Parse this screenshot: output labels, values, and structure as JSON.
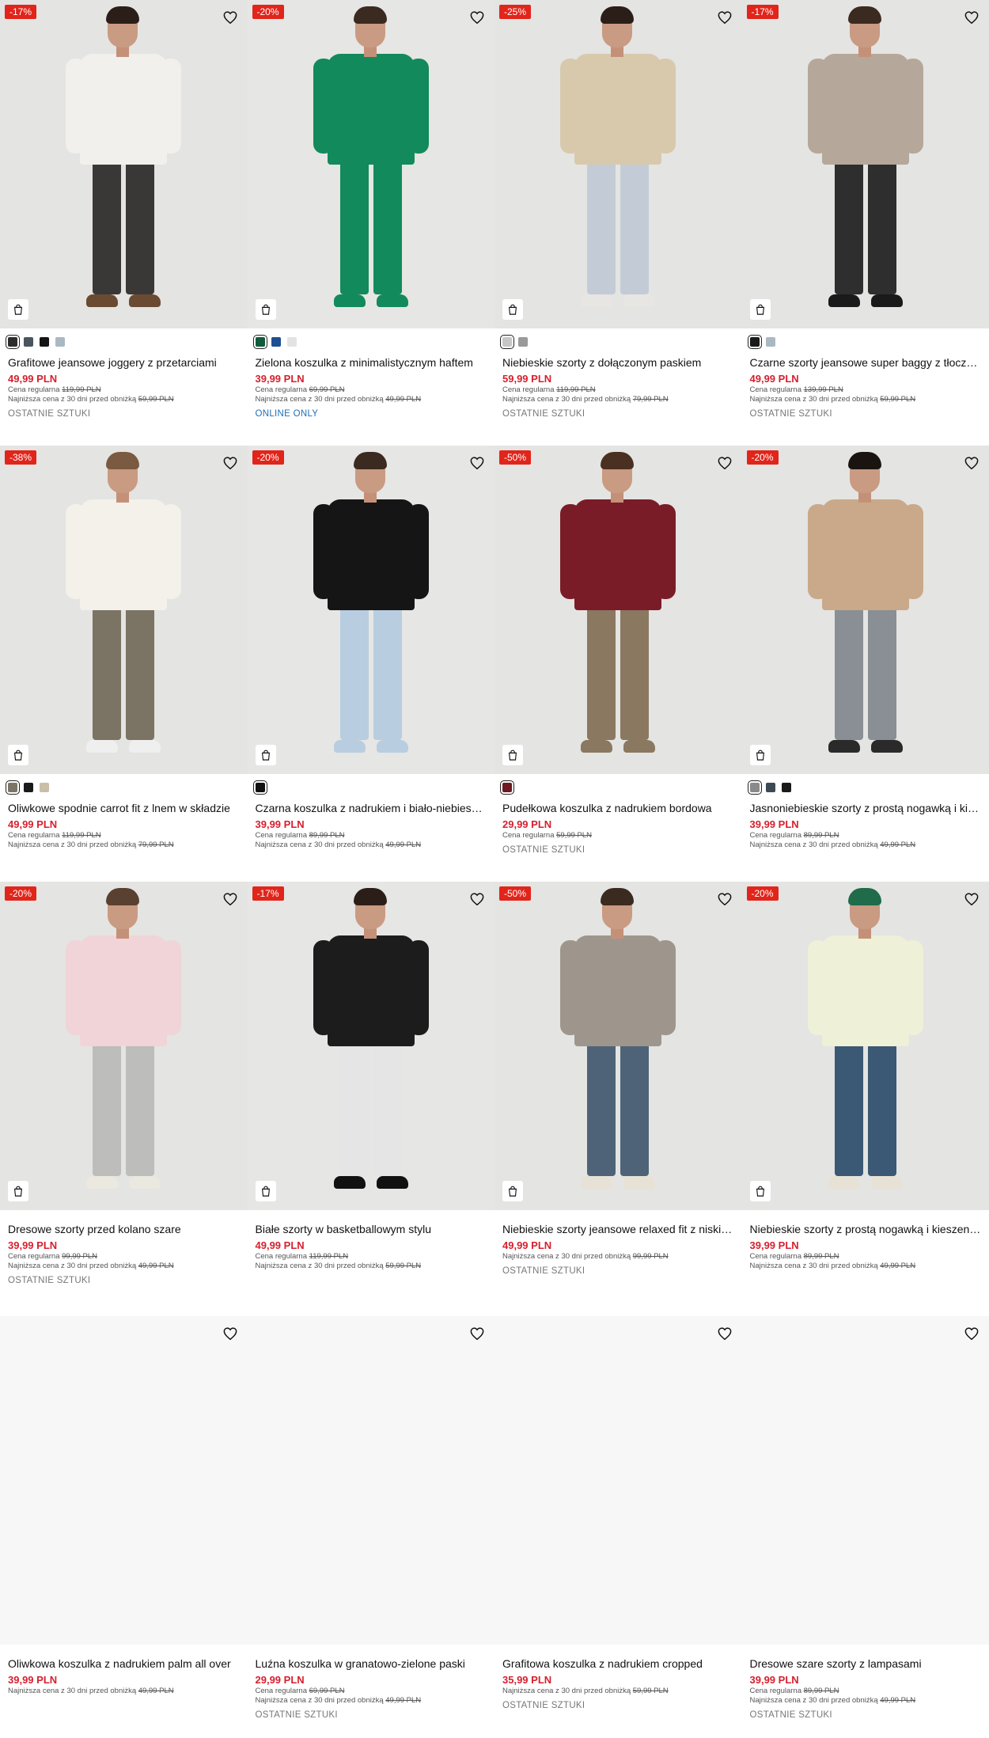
{
  "labels": {
    "regular_prefix": "Cena regularna",
    "lowest_prefix": "Najniższa cena z 30 dni przed obniżką"
  },
  "products": [
    {
      "title": "Grafitowe jeansowe joggery z przetarciami",
      "price": "49,99 PLN",
      "regular": "119,99 PLN",
      "lowest": "59,99 PLN",
      "badge": "-17%",
      "tag": "OSTATNIE SZTUKI",
      "tag_type": "last",
      "swatches": [
        "#2c2c2c",
        "#4a5560",
        "#151515",
        "#a9b9c4"
      ],
      "outfit": {
        "top": "#f1f0ed",
        "bottom": "#3a3836",
        "shoe": "#6b4a32",
        "hair": "#2b1e18"
      }
    },
    {
      "title": "Zielona koszulka z minimalistycznym haftem",
      "price": "39,99 PLN",
      "regular": "69,99 PLN",
      "lowest": "49,99 PLN",
      "badge": "-20%",
      "tag": "ONLINE ONLY",
      "tag_type": "online",
      "swatches": [
        "#0f5b3c",
        "#1d4f93",
        "#e3e3e3"
      ],
      "outfit": {
        "top": "#128a5c",
        "bottom": "#128a5c",
        "shoe": "#128a5c",
        "hair": "#3b2a20"
      }
    },
    {
      "title": "Niebieskie szorty z dołączonym paskiem",
      "price": "59,99 PLN",
      "regular": "119,99 PLN",
      "lowest": "79,99 PLN",
      "badge": "-25%",
      "tag": "OSTATNIE SZTUKI",
      "tag_type": "last",
      "swatches": [
        "#c7c7c7",
        "#9a9a9a"
      ],
      "outfit": {
        "top": "#d8c9ad",
        "bottom": "#c3ccd6",
        "shoe": "#e8e6e2",
        "hair": "#2b1e18"
      }
    },
    {
      "title": "Czarne szorty jeansowe super baggy z tłoczeniem",
      "price": "49,99 PLN",
      "regular": "139,99 PLN",
      "lowest": "59,99 PLN",
      "badge": "-17%",
      "tag": "OSTATNIE SZTUKI",
      "tag_type": "last",
      "swatches": [
        "#1a1a1a",
        "#a9b9c4"
      ],
      "outfit": {
        "top": "#b5a89a",
        "bottom": "#2e2e2e",
        "shoe": "#1a1a1a",
        "hair": "#3b2a20"
      }
    },
    {
      "title": "Oliwkowe spodnie carrot fit z lnem w składzie",
      "price": "49,99 PLN",
      "regular": "119,99 PLN",
      "lowest": "79,99 PLN",
      "badge": "-38%",
      "tag": "",
      "tag_type": "none",
      "swatches": [
        "#7c7566",
        "#1a1a1a",
        "#c9bfa6"
      ],
      "outfit": {
        "top": "#f3f1ea",
        "bottom": "#7b7363",
        "shoe": "#efefef",
        "hair": "#7a5a40"
      }
    },
    {
      "title": "Czarna koszulka z nadrukiem i biało-niebieskimi wstawkami",
      "price": "39,99 PLN",
      "regular": "89,99 PLN",
      "lowest": "49,99 PLN",
      "badge": "-20%",
      "tag": "",
      "tag_type": "none",
      "swatches": [
        "#111111"
      ],
      "outfit": {
        "top": "#151515",
        "bottom": "#b8cde0",
        "shoe": "#b8cde0",
        "hair": "#3b2a20"
      }
    },
    {
      "title": "Pudełkowa koszulka z nadrukiem bordowa",
      "price": "29,99 PLN",
      "regular": "59,99 PLN",
      "lowest": "",
      "badge": "-50%",
      "tag": "OSTATNIE SZTUKI",
      "tag_type": "last",
      "swatches": [
        "#6e1a22"
      ],
      "outfit": {
        "top": "#7a1c27",
        "bottom": "#8a7860",
        "shoe": "#8a7860",
        "hair": "#4a3020"
      }
    },
    {
      "title": "Jasnoniebieskie szorty z prostą nogawką i kieszeniami cargo",
      "price": "39,99 PLN",
      "regular": "89,99 PLN",
      "lowest": "49,99 PLN",
      "badge": "-20%",
      "tag": "",
      "tag_type": "none",
      "swatches": [
        "#8a8a8a",
        "#3c4a55",
        "#1a1a1a"
      ],
      "outfit": {
        "top": "#c9a98a",
        "bottom": "#8a8f95",
        "shoe": "#2a2a2a",
        "hair": "#1a1410"
      }
    },
    {
      "title": "Dresowe szorty przed kolano szare",
      "price": "39,99 PLN",
      "regular": "99,99 PLN",
      "lowest": "49,99 PLN",
      "badge": "-20%",
      "tag": "OSTATNIE SZTUKI",
      "tag_type": "last",
      "swatches": [],
      "outfit": {
        "top": "#f0d4d8",
        "bottom": "#bdbdbb",
        "shoe": "#ebe8df",
        "hair": "#5a4030"
      }
    },
    {
      "title": "Białe szorty w basketballowym stylu",
      "price": "49,99 PLN",
      "regular": "119,99 PLN",
      "lowest": "59,99 PLN",
      "badge": "-17%",
      "tag": "",
      "tag_type": "none",
      "swatches": [],
      "outfit": {
        "top": "#1c1c1c",
        "bottom": "#e5e5e5",
        "shoe": "#111111",
        "hair": "#2b1e18"
      }
    },
    {
      "title": "Niebieskie szorty jeansowe relaxed fit z niskim stanem",
      "price": "49,99 PLN",
      "regular": "",
      "lowest": "99,99 PLN",
      "badge": "-50%",
      "tag": "OSTATNIE SZTUKI",
      "tag_type": "last",
      "swatches": [],
      "outfit": {
        "top": "#9e968c",
        "bottom": "#4e6377",
        "shoe": "#e8e2d6",
        "hair": "#3b2a20"
      }
    },
    {
      "title": "Niebieskie szorty z prostą nogawką i kieszeniami cargo",
      "price": "39,99 PLN",
      "regular": "89,99 PLN",
      "lowest": "49,99 PLN",
      "badge": "-20%",
      "tag": "",
      "tag_type": "none",
      "swatches": [],
      "outfit": {
        "top": "#eef0d8",
        "bottom": "#3b5875",
        "shoe": "#e8e2d6",
        "hair": "#1f6b4a"
      }
    },
    {
      "title": "Oliwkowa koszulka z nadrukiem palm all over",
      "price": "39,99 PLN",
      "regular": "",
      "lowest": "49,99 PLN",
      "badge": "",
      "tag": "",
      "tag_type": "none",
      "swatches": [],
      "outfit": null
    },
    {
      "title": "Luźna koszulka w granatowo-zielone paski",
      "price": "29,99 PLN",
      "regular": "69,99 PLN",
      "lowest": "49,99 PLN",
      "badge": "",
      "tag": "OSTATNIE SZTUKI",
      "tag_type": "last",
      "swatches": [],
      "outfit": null
    },
    {
      "title": "Grafitowa koszulka z nadrukiem cropped",
      "price": "35,99 PLN",
      "regular": "",
      "lowest": "59,99 PLN",
      "badge": "",
      "tag": "OSTATNIE SZTUKI",
      "tag_type": "last",
      "swatches": [],
      "outfit": null
    },
    {
      "title": "Dresowe szare szorty z lampasami",
      "price": "39,99 PLN",
      "regular": "89,99 PLN",
      "lowest": "49,99 PLN",
      "badge": "",
      "tag": "OSTATNIE SZTUKI",
      "tag_type": "last",
      "swatches": [],
      "outfit": null
    }
  ],
  "icons": {
    "favorite": "heart-icon",
    "cart": "shopping-bag-icon"
  }
}
